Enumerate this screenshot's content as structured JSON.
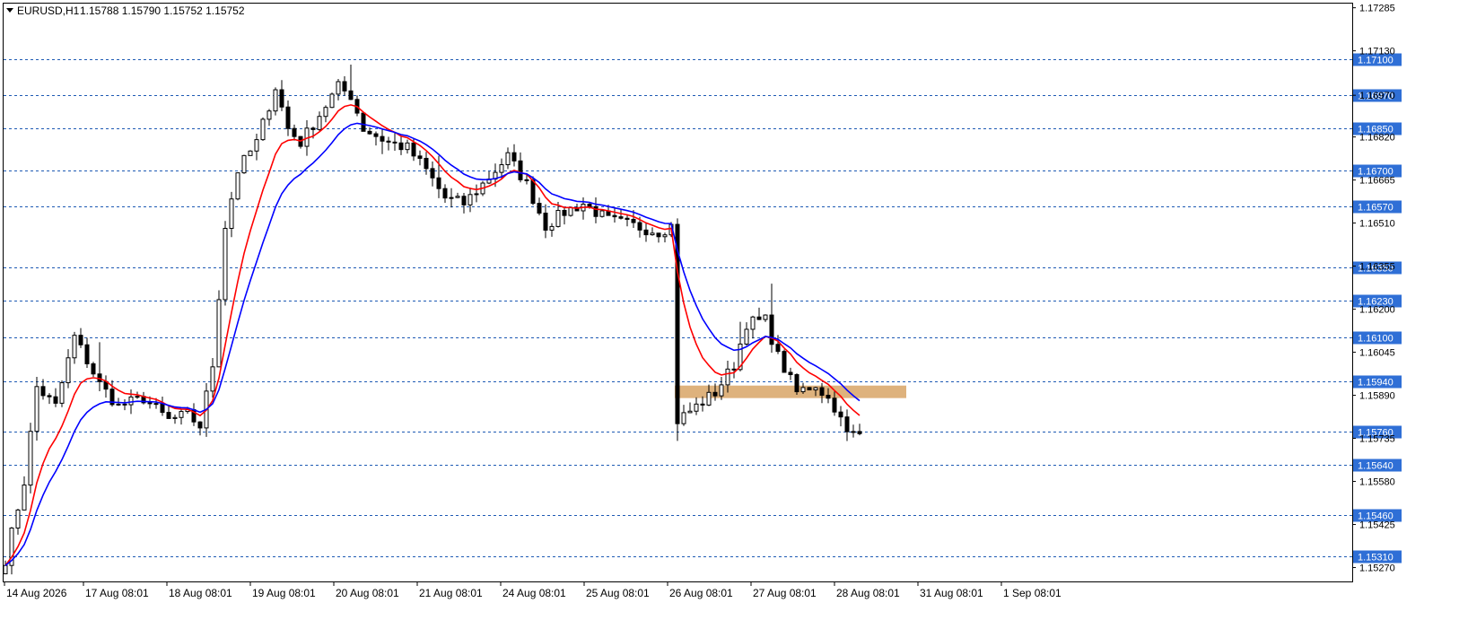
{
  "header": {
    "arrow_icon": "triangle-down-icon",
    "symbol": "EURUSD,H1",
    "ohlc": "1.15788 1.15790 1.15752 1.15752"
  },
  "colors": {
    "background": "#ffffff",
    "frame": "#000000",
    "level_line": "#1e5ab4",
    "level_tag_bg": "#2f6fd6",
    "level_tag_text": "#ffffff",
    "ma_fast": "#ff0000",
    "ma_slow": "#0000ff",
    "candle": "#000000",
    "zone": "#d8a566"
  },
  "chart_data": {
    "type": "candlestick",
    "symbol": "EURUSD",
    "timeframe": "H1",
    "ylim": [
      1.1522,
      1.173
    ],
    "y_ticks": [
      "1.17285",
      "1.17130",
      "1.16970",
      "1.16820",
      "1.16665",
      "1.16510",
      "1.16355",
      "1.16200",
      "1.16045",
      "1.15890",
      "1.15735",
      "1.15580",
      "1.15425",
      "1.15270"
    ],
    "x_ticks": [
      "14 Aug 2026",
      "17 Aug 08:01",
      "18 Aug 08:01",
      "19 Aug 08:01",
      "20 Aug 08:01",
      "21 Aug 08:01",
      "24 Aug 08:01",
      "25 Aug 08:01",
      "26 Aug 08:01",
      "27 Aug 08:01",
      "28 Aug 08:01",
      "31 Aug 08:01",
      "1 Sep 08:01"
    ],
    "levels": [
      "1.17100",
      "1.16970",
      "1.16850",
      "1.16700",
      "1.16570",
      "1.16350",
      "1.16230",
      "1.16100",
      "1.15940",
      "1.15760",
      "1.15640",
      "1.15460",
      "1.15310"
    ],
    "zone": {
      "from": 1.1588,
      "to": 1.15925,
      "start_bar": 107,
      "end_bar": 143
    },
    "last_close": 1.15752,
    "close_path": [
      [
        0,
        1.153
      ],
      [
        3,
        1.1558
      ],
      [
        5,
        1.1592
      ],
      [
        8,
        1.1585
      ],
      [
        11,
        1.161
      ],
      [
        15,
        1.1593
      ],
      [
        18,
        1.1585
      ],
      [
        22,
        1.1588
      ],
      [
        26,
        1.158
      ],
      [
        29,
        1.1582
      ],
      [
        31,
        1.1578
      ],
      [
        33,
        1.16
      ],
      [
        35,
        1.165
      ],
      [
        37,
        1.167
      ],
      [
        40,
        1.168
      ],
      [
        43,
        1.17
      ],
      [
        45,
        1.1685
      ],
      [
        47,
        1.168
      ],
      [
        50,
        1.169
      ],
      [
        53,
        1.17
      ],
      [
        55,
        1.1697
      ],
      [
        57,
        1.1685
      ],
      [
        61,
        1.168
      ],
      [
        64,
        1.1678
      ],
      [
        67,
        1.167
      ],
      [
        70,
        1.166
      ],
      [
        73,
        1.1658
      ],
      [
        76,
        1.1665
      ],
      [
        80,
        1.1675
      ],
      [
        83,
        1.1665
      ],
      [
        86,
        1.165
      ],
      [
        89,
        1.1655
      ],
      [
        92,
        1.1658
      ],
      [
        96,
        1.1652
      ],
      [
        100,
        1.165
      ],
      [
        104,
        1.1648
      ],
      [
        106,
        1.165
      ],
      [
        107,
        1.158
      ],
      [
        110,
        1.1585
      ],
      [
        113,
        1.159
      ],
      [
        116,
        1.16
      ],
      [
        118,
        1.1615
      ],
      [
        121,
        1.1616
      ],
      [
        123,
        1.1603
      ],
      [
        126,
        1.159
      ],
      [
        129,
        1.1593
      ],
      [
        132,
        1.1585
      ],
      [
        134,
        1.1575
      ]
    ],
    "series": [
      {
        "values": []
      },
      {
        "values": []
      }
    ]
  }
}
